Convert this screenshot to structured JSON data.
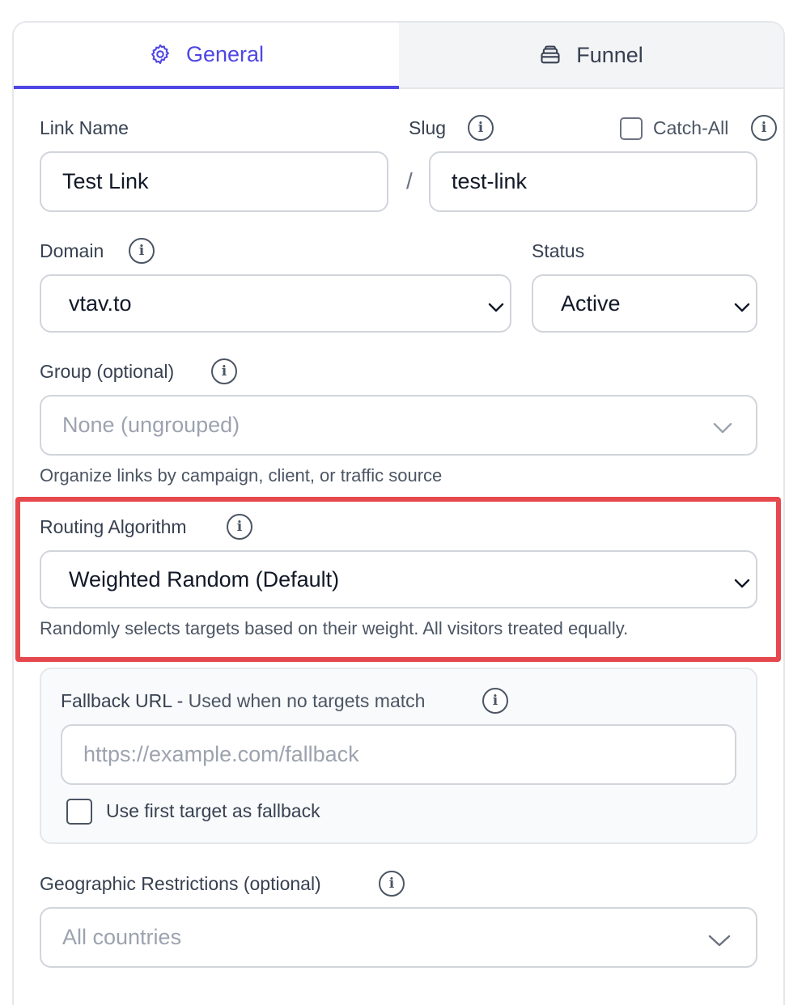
{
  "tabs": [
    {
      "label": "General",
      "icon": "gear-icon",
      "active": true
    },
    {
      "label": "Funnel",
      "icon": "funnel-icon",
      "active": false
    }
  ],
  "link_name": {
    "label": "Link Name",
    "value": "Test Link"
  },
  "slug": {
    "label": "Slug",
    "separator": "/",
    "value": "test-link"
  },
  "catch_all": {
    "label": "Catch-All",
    "checked": false
  },
  "domain": {
    "label": "Domain",
    "value": "vtav.to"
  },
  "status": {
    "label": "Status",
    "value": "Active"
  },
  "group": {
    "label": "Group (optional)",
    "placeholder": "None (ungrouped)",
    "help": "Organize links by campaign, client, or traffic source"
  },
  "routing": {
    "label": "Routing Algorithm",
    "value": "Weighted Random (Default)",
    "help": "Randomly selects targets based on their weight. All visitors treated equally."
  },
  "fallback": {
    "label_main": "Fallback URL",
    "label_sep": " - ",
    "label_sub": "Used when no targets match",
    "placeholder": "https://example.com/fallback",
    "use_first_label": "Use first target as fallback",
    "use_first_checked": false
  },
  "geo": {
    "label": "Geographic Restrictions (optional)",
    "placeholder": "All countries"
  },
  "colors": {
    "accent": "#4f46e5",
    "highlight": "#e5484d",
    "border": "#d1d5db"
  }
}
